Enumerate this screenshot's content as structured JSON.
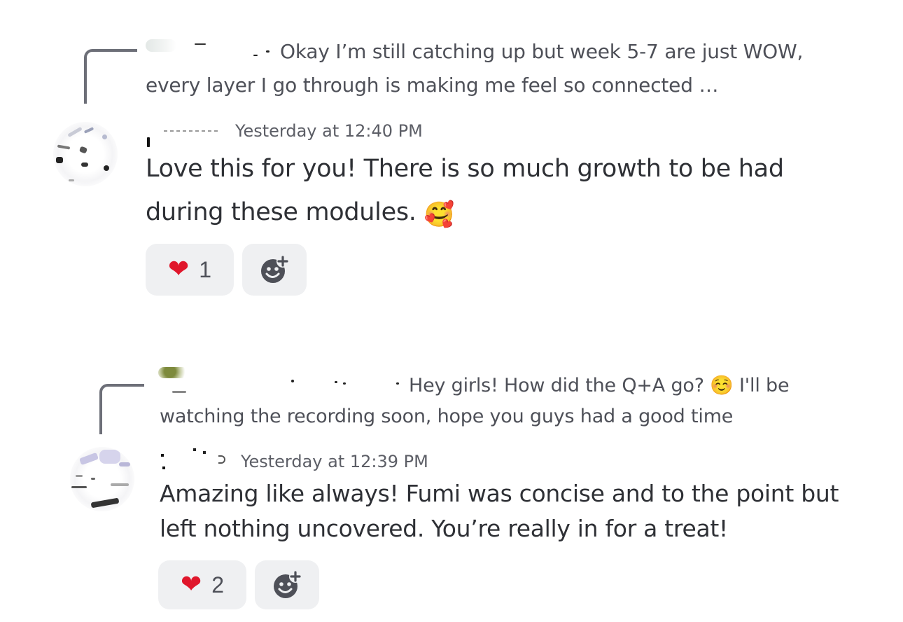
{
  "messages": [
    {
      "reply": {
        "text": "Okay I’m still catching up but week 5-7 are just WOW, every layer I go through is making me feel so connected …"
      },
      "timestamp": "Yesterday at 12:40 PM",
      "content": "Love this for you! There is so much growth to be had during these modules.",
      "content_emoji": "🥰",
      "reactions": [
        {
          "emoji": "heart-icon",
          "count": "1"
        },
        {
          "emoji": "add-reaction-icon"
        }
      ]
    },
    {
      "reply": {
        "text": "Hey girls! How did the Q+A go? ☺️ I'll be watching the recording soon, hope you guys had a good time"
      },
      "timestamp": "Yesterday at 12:39 PM",
      "content": "Amazing like always! Fumi was concise and to the point but left nothing uncovered. You’re really in for a treat!",
      "reactions": [
        {
          "emoji": "heart-icon",
          "count": "2"
        },
        {
          "emoji": "add-reaction-icon"
        }
      ]
    }
  ],
  "colors": {
    "heart": "#e0162b",
    "reaction_bg": "#eff0f2",
    "spine": "#6d6f78",
    "reply_text": "#4e5058",
    "timestamp": "#5c5e66"
  }
}
